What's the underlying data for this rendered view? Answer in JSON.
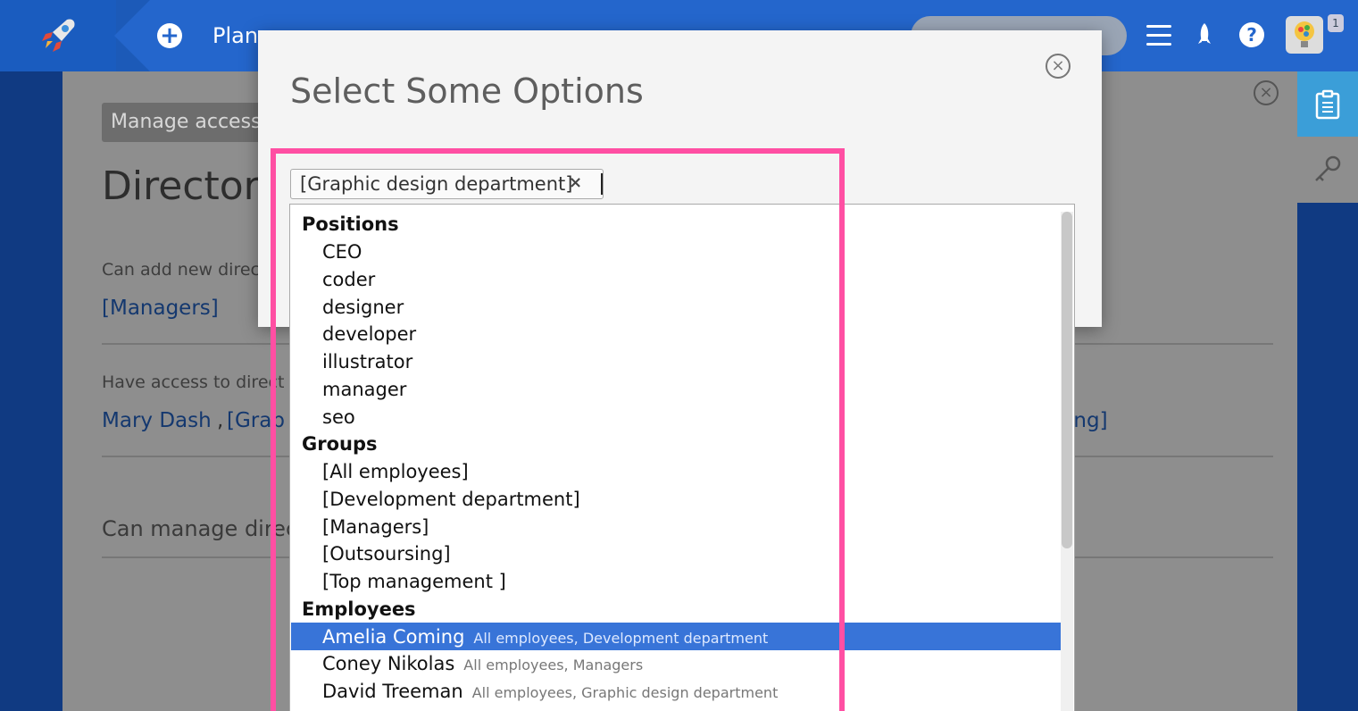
{
  "topbar": {
    "nav_text": "Plan",
    "colors": {
      "bar": "#2466cc",
      "annotation": "#ff4fa3"
    }
  },
  "icons": {
    "logo": "rocket-icon",
    "add": "plus-icon",
    "menu": "hamburger-menu-icon",
    "launch": "rocket-icon",
    "help": "question-icon",
    "user": "avatar"
  },
  "user": {
    "badge": "1"
  },
  "page": {
    "manage_button": "Manage access",
    "title": "Directory",
    "label_add": "Can add new direc",
    "link_managers": "[Managers]",
    "label_access": "Have access to direct",
    "link_mary": "Mary Dash",
    "link_sep": ",",
    "link_graph": "[Grap",
    "link_ing": "ing]",
    "heading_manage": "Can manage direc"
  },
  "modal": {
    "title": "Select Some Options",
    "selected_chip": "[Graphic design department]",
    "chip_remove": "×",
    "close": "×"
  },
  "dropdown": {
    "groups": [
      {
        "label": "Positions",
        "items": [
          "CEO",
          "coder",
          "designer",
          "developer",
          "illustrator",
          "manager",
          "seo"
        ]
      },
      {
        "label": "Groups",
        "items": [
          "[All employees]",
          "[Development department]",
          "[Managers]",
          "[Outsoursing]",
          "[Top management ]"
        ]
      },
      {
        "label": "Employees",
        "items": [
          {
            "name": "Amelia Coming",
            "sub": "All employees, Development department",
            "highlighted": true
          },
          {
            "name": "Coney Nikolas",
            "sub": "All employees, Managers"
          },
          {
            "name": "David Treeman",
            "sub": "All employees, Graphic design department"
          }
        ]
      }
    ]
  }
}
